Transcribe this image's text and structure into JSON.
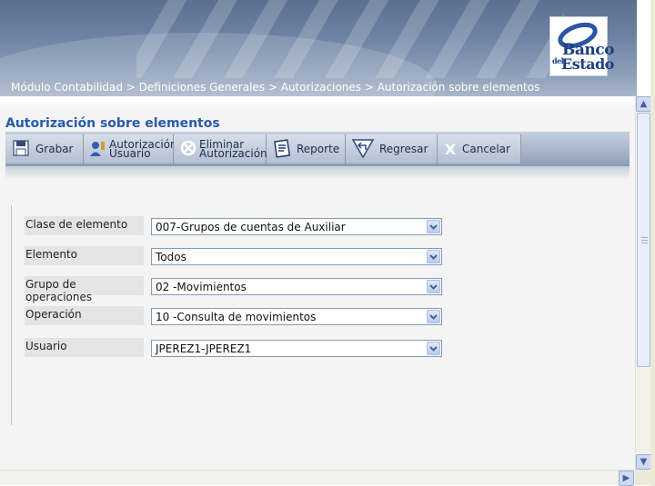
{
  "header": {
    "breadcrumb": "Módulo Contabilidad > Definiciones Generales > Autorizaciones > Autorización sobre elementos",
    "logo": {
      "line1": "Banco",
      "small": "del",
      "line2": "Estado"
    }
  },
  "page": {
    "title": "Autorización sobre elementos"
  },
  "toolbar": {
    "grabar": "Grabar",
    "autorizacion_line1": "Autorización",
    "autorizacion_line2": "Usuario",
    "eliminar_line1": "Eliminar",
    "eliminar_line2": "Autorización",
    "reporte": "Reporte",
    "regresar": "Regresar",
    "cancelar": "Cancelar"
  },
  "form": {
    "clase": {
      "label": "Clase de elemento",
      "value": "007-Grupos de cuentas de Auxiliar"
    },
    "elemento": {
      "label": "Elemento",
      "value": "Todos"
    },
    "grupo": {
      "label": "Grupo de operaciones",
      "value": "02 -Movimientos"
    },
    "operacion": {
      "label": "Operación",
      "value": "10 -Consulta de movimientos"
    },
    "usuario": {
      "label": "Usuario",
      "value": "JPEREZ1-JPEREZ1"
    }
  },
  "icons": {
    "grabar": "save-icon",
    "autorizacion": "user-key-icon",
    "eliminar": "delete-icon",
    "reporte": "report-icon",
    "regresar": "back-arrow-icon",
    "cancelar": "x-icon"
  },
  "colors": {
    "title": "#2b5aa8",
    "banner": "#6f84a4",
    "toolbar": "#a8b6cb"
  }
}
